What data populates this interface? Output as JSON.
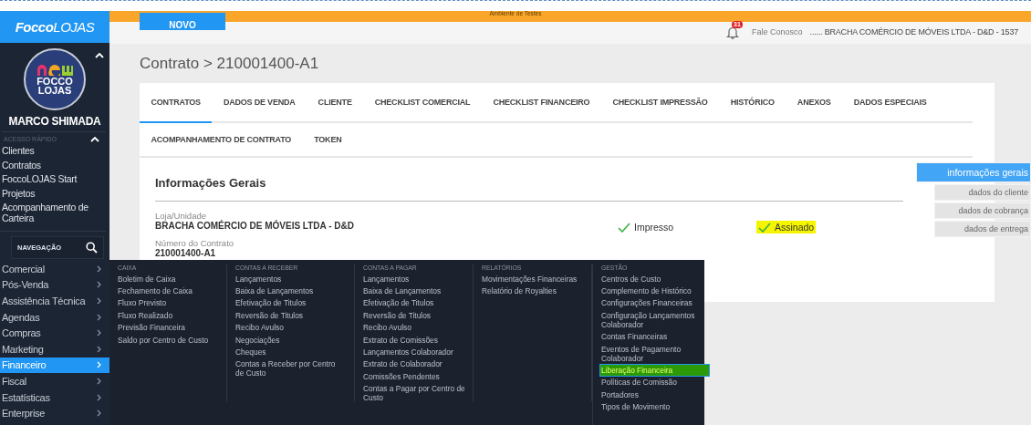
{
  "sidebar": {
    "logo": "**Focco**LOJAS",
    "avatar_lines": [
      "FOCCO",
      "LOJAS"
    ],
    "user_name": "MARCO SHIMADA",
    "quick_access": {
      "title": "ACESSO RÁPIDO",
      "expanded": true,
      "items": [
        "Clientes",
        "Contratos",
        "FoccoLOJAS Start",
        "Projetos",
        "Acompanhamento de Carteira"
      ]
    },
    "navigation": {
      "title": "NAVEGAÇÃO",
      "items": [
        {
          "label": "Comercial",
          "selected": false
        },
        {
          "label": "Pós-Venda",
          "selected": false
        },
        {
          "label": "Assistência Técnica",
          "selected": false
        },
        {
          "label": "Agendas",
          "selected": false
        },
        {
          "label": "Compras",
          "selected": false
        },
        {
          "label": "Marketing",
          "selected": false
        },
        {
          "label": "Financeiro",
          "selected": true
        },
        {
          "label": "Fiscal",
          "selected": false
        },
        {
          "label": "Estatísticas",
          "selected": false
        },
        {
          "label": "Enterprise",
          "selected": false
        }
      ]
    }
  },
  "environment_banner": "Ambiente de Testes",
  "header": {
    "new_button": "NOVO",
    "notification_count": "31",
    "contact_link": "Fale Conosco",
    "company": "...... BRACHA COMÉRCIO DE MÓVEIS LTDA - D&D - 1537"
  },
  "breadcrumb": "Contrato > 210001400-A1",
  "tabs": [
    {
      "label": "CONTRATOS",
      "selected": true
    },
    {
      "label": "DADOS DE VENDA",
      "selected": false
    },
    {
      "label": "CLIENTE",
      "selected": false
    },
    {
      "label": "CHECKLIST COMERCIAL",
      "selected": false
    },
    {
      "label": "CHECKLIST FINANCEIRO",
      "selected": false
    },
    {
      "label": "CHECKLIST IMPRESSÃO",
      "selected": false
    },
    {
      "label": "HISTÓRICO",
      "selected": false
    },
    {
      "label": "ANEXOS",
      "selected": false
    },
    {
      "label": "DADOS ESPECIAIS",
      "selected": false
    },
    {
      "label": "ACOMPANHAMENTO DE CONTRATO",
      "selected": false
    },
    {
      "label": "TOKEN",
      "selected": false
    }
  ],
  "section": {
    "title": "Informações Gerais",
    "fields": [
      {
        "label": "Loja/Unidade",
        "value": "BRACHA COMÉRCIO DE MÓVEIS LTDA - D&D"
      },
      {
        "label": "Número do Contrato",
        "value": "210001400-A1"
      }
    ],
    "statuses": [
      {
        "label": "Impresso",
        "checked": true,
        "highlighted": false
      },
      {
        "label": "Assinado",
        "checked": true,
        "highlighted": true
      }
    ]
  },
  "side_nav": [
    {
      "label": "informações gerais",
      "selected": true
    },
    {
      "label": "dados do cliente",
      "selected": false
    },
    {
      "label": "dados de cobrança",
      "selected": false
    },
    {
      "label": "dados de entrega",
      "selected": false
    }
  ],
  "mega_menu": {
    "columns": [
      {
        "title": "CAIXA",
        "items": [
          {
            "label": "Boletim de Caixa",
            "selected": false
          },
          {
            "label": "Fechamento de Caixa",
            "selected": false
          },
          {
            "label": "Fluxo Previsto",
            "selected": false
          },
          {
            "label": "Fluxo Realizado",
            "selected": false
          },
          {
            "label": "Previsão Financeira",
            "selected": false
          },
          {
            "label": "Saldo por Centro de Custo",
            "selected": false
          }
        ]
      },
      {
        "title": "CONTAS A RECEBER",
        "items": [
          {
            "label": "Lançamentos",
            "selected": false
          },
          {
            "label": "Baixa de Lançamentos",
            "selected": false
          },
          {
            "label": "Efetivação de Titulos",
            "selected": false
          },
          {
            "label": "Reversão de Titulos",
            "selected": false
          },
          {
            "label": "Recibo Avulso",
            "selected": false
          },
          {
            "label": "Negociações",
            "selected": false
          },
          {
            "label": "Cheques",
            "selected": false
          },
          {
            "label": "Contas a Receber por Centro de Custo",
            "selected": false
          }
        ]
      },
      {
        "title": "CONTAS A PAGAR",
        "items": [
          {
            "label": "Lançamentos",
            "selected": false
          },
          {
            "label": "Baixa de Lançamentos",
            "selected": false
          },
          {
            "label": "Efetivação de Titulos",
            "selected": false
          },
          {
            "label": "Reversão de Titulos",
            "selected": false
          },
          {
            "label": "Recibo Avulso",
            "selected": false
          },
          {
            "label": "Extrato de Comissões",
            "selected": false
          },
          {
            "label": "Lançamentos Colaborador",
            "selected": false
          },
          {
            "label": "Extrato de Colaborador",
            "selected": false
          },
          {
            "label": "Comissões Pendentes",
            "selected": false
          },
          {
            "label": "Contas a Pagar por Centro de Custo",
            "selected": false
          }
        ]
      },
      {
        "title": "RELATÓRIOS",
        "items": [
          {
            "label": "Movimentações Financeiras",
            "selected": false
          },
          {
            "label": "Relatório de Royalties",
            "selected": false
          }
        ]
      },
      {
        "title": "GESTÃO",
        "items": [
          {
            "label": "Centros de Custo",
            "selected": false
          },
          {
            "label": "Complemento de Histórico",
            "selected": false
          },
          {
            "label": "Configurações Financeiras",
            "selected": false
          },
          {
            "label": "Configuração Lançamentos Colaborador",
            "selected": false
          },
          {
            "label": "Contas Financeiras",
            "selected": false
          },
          {
            "label": "Eventos de Pagamento Colaborador",
            "selected": false
          },
          {
            "label": "Liberação Financeira",
            "selected": true
          },
          {
            "label": "Políticas de Comissão",
            "selected": false
          },
          {
            "label": "Portadores",
            "selected": false
          },
          {
            "label": "Tipos de Movimento",
            "selected": false
          }
        ]
      }
    ]
  }
}
